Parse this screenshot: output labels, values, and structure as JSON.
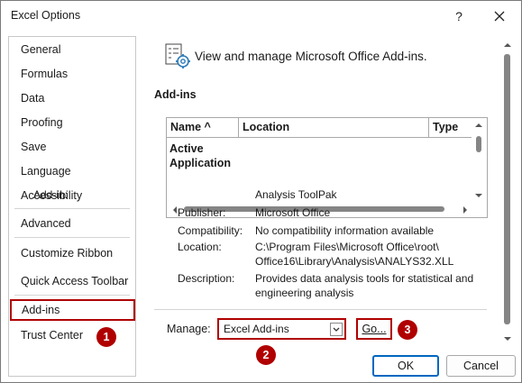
{
  "window": {
    "title": "Excel Options",
    "help": "?",
    "accent": "#b00000",
    "ok_accent": "#0067c0"
  },
  "nav": {
    "items": [
      {
        "label": "General"
      },
      {
        "label": "Formulas"
      },
      {
        "label": "Data"
      },
      {
        "label": "Proofing"
      },
      {
        "label": "Save"
      },
      {
        "label": "Language"
      },
      {
        "label": "Accessibility"
      },
      {
        "label": "Advanced"
      },
      {
        "label": "Customize Ribbon"
      },
      {
        "label": "Quick Access Toolbar"
      },
      {
        "label": "Add-ins",
        "selected": true
      },
      {
        "label": "Trust Center"
      }
    ]
  },
  "header": {
    "text": "View and manage Microsoft Office Add-ins.",
    "icon": "addins-gear-icon"
  },
  "addins": {
    "section_label": "Add-ins",
    "columns": [
      "Name ^",
      "Location",
      "Type"
    ],
    "rows": [
      "Active",
      "Application"
    ]
  },
  "details": {
    "addin_label": "Add-in:",
    "addin_value": "Analysis ToolPak",
    "publisher_label": "Publisher:",
    "publisher_value": "Microsoft Office",
    "compat_label": "Compatibility:",
    "compat_value": "No compatibility information available",
    "location_label": "Location:",
    "location_line1": "C:\\Program Files\\Microsoft Office\\root\\",
    "location_line2": "Office16\\Library\\Analysis\\ANALYS32.XLL",
    "desc_label": "Description:",
    "desc_line1": "Provides data analysis tools for statistical and",
    "desc_line2": "engineering analysis"
  },
  "manage": {
    "label": "Manage:",
    "selected": "Excel Add-ins",
    "go_label": "Go..."
  },
  "badges": [
    "1",
    "2",
    "3"
  ],
  "buttons": {
    "ok": "OK",
    "cancel": "Cancel"
  }
}
